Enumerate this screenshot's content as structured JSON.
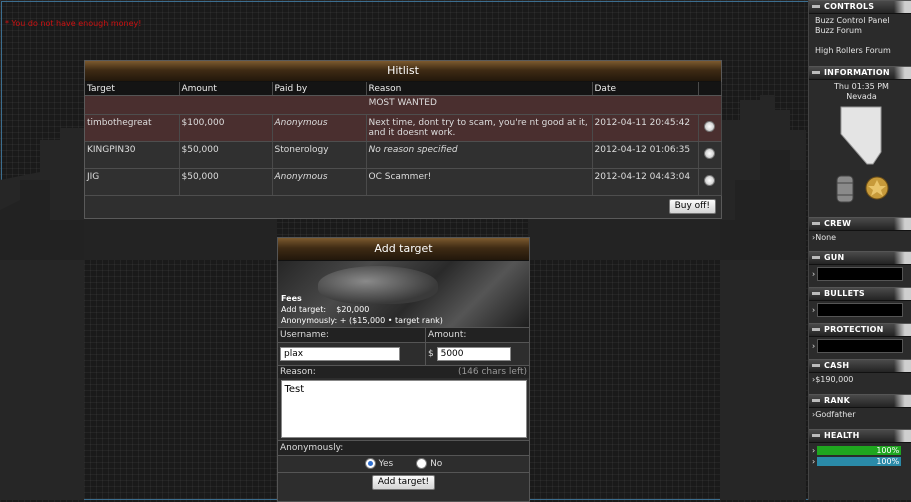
{
  "error_message": "* You do not have enough money!",
  "hitlist": {
    "title": "Hitlist",
    "columns": [
      "Target",
      "Amount",
      "Paid by",
      "Reason",
      "Date",
      ""
    ],
    "most_wanted_label": "MOST WANTED",
    "rows": [
      {
        "target": "timbothegreat",
        "amount": "$100,000",
        "paid_by": "Anonymous",
        "reason": "Next time, dont try to scam, you're nt good at it, and it doesnt work.",
        "date": "2012-04-11 20:45:42"
      },
      {
        "target": "KINGPIN30",
        "amount": "$50,000",
        "paid_by": "Stonerology",
        "reason": "No reason specified",
        "date": "2012-04-12 01:06:35"
      },
      {
        "target": "JIG",
        "amount": "$50,000",
        "paid_by": "Anonymous",
        "reason": "OC Scammer!",
        "date": "2012-04-12 04:43:04"
      }
    ],
    "buy_off_label": "Buy off!"
  },
  "add_target": {
    "title": "Add target",
    "fees_title": "Fees",
    "fees_add_label": "Add target:",
    "fees_add_value": "$20,000",
    "fees_anon": "Anonymously: + ($15,000 • target rank)",
    "username_label": "Username:",
    "username_value": "plax",
    "amount_label": "Amount:",
    "currency": "$",
    "amount_value": "5000",
    "reason_label": "Reason:",
    "chars_left": "(146 chars left)",
    "reason_value": "Test",
    "anonymously_label": "Anonymously:",
    "yes_label": "Yes",
    "no_label": "No",
    "anonymously_selected": "yes",
    "submit_label": "Add target!"
  },
  "sidebar": {
    "controls": {
      "title": "CONTROLS",
      "links": [
        "Buzz Control Panel",
        "Buzz Forum",
        "High Rollers Forum"
      ]
    },
    "information": {
      "title": "INFORMATION",
      "time": "Thu 01:35 PM",
      "location": "Nevada"
    },
    "crew": {
      "title": "CREW",
      "value": "None"
    },
    "gun": {
      "title": "GUN"
    },
    "bullets": {
      "title": "BULLETS"
    },
    "protection": {
      "title": "PROTECTION"
    },
    "cash": {
      "title": "CASH",
      "value": "$190,000"
    },
    "rank": {
      "title": "RANK",
      "value": "Godfather"
    },
    "health": {
      "title": "HEALTH",
      "bars": [
        {
          "value": "100%",
          "color": "#1fa61f"
        },
        {
          "value": "100%",
          "color": "#2a8aa8"
        }
      ]
    }
  }
}
